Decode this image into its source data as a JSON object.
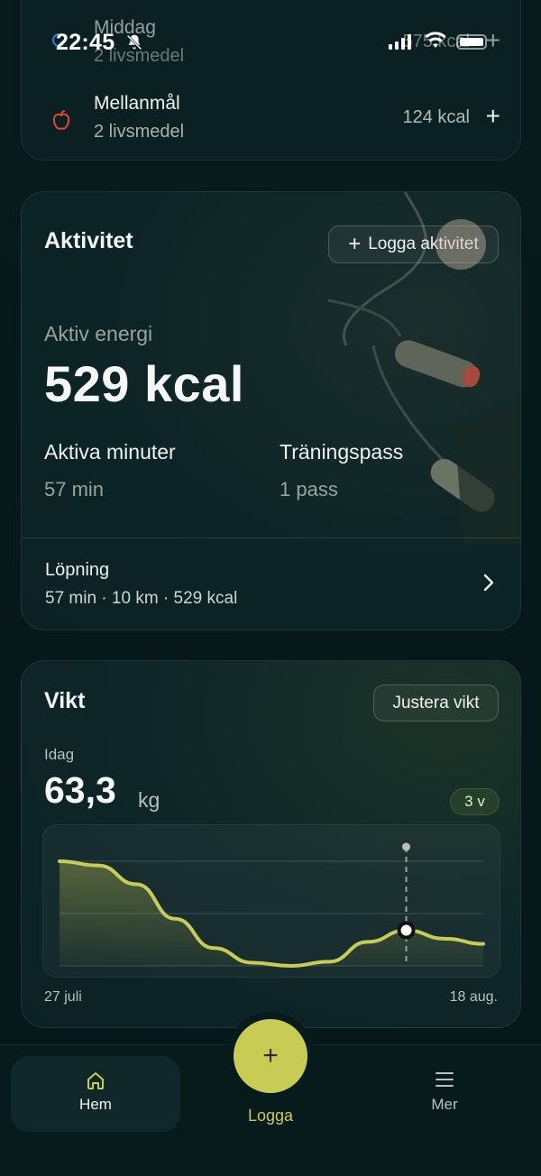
{
  "status_bar": {
    "time": "22:45"
  },
  "meals": {
    "items": [
      {
        "name": "Middag",
        "sub": "2 livsmedel",
        "kcal": "575 kcal"
      },
      {
        "name": "Mellanmål",
        "sub": "2 livsmedel",
        "kcal": "124 kcal"
      }
    ]
  },
  "activity": {
    "title": "Aktivitet",
    "log_button": "Logga aktivitet",
    "energy_label": "Aktiv energi",
    "energy_value": "529 kcal",
    "minutes_label": "Aktiva minuter",
    "minutes_value": "57 min",
    "sessions_label": "Träningspass",
    "sessions_value": "1 pass",
    "session": {
      "name": "Löpning",
      "meta": "57 min · 10 km · 529 kcal"
    }
  },
  "weight": {
    "title": "Vikt",
    "adjust_button": "Justera vikt",
    "today_label": "Idag",
    "value": "63,3",
    "unit": "kg",
    "range": "3 v",
    "x_start": "27 juli",
    "x_end": "18 aug.",
    "accent": "#c9cc54"
  },
  "chart_data": {
    "type": "line",
    "x": [
      "27 juli",
      "18 aug."
    ],
    "series": [
      {
        "values": [
          1.0,
          0.96,
          0.78,
          0.45,
          0.17,
          0.03,
          0.0,
          0.04,
          0.23,
          0.34,
          0.26,
          0.21
        ]
      }
    ],
    "grid": true
  },
  "nav": {
    "home": "Hem",
    "log": "Logga",
    "more": "Mer"
  }
}
